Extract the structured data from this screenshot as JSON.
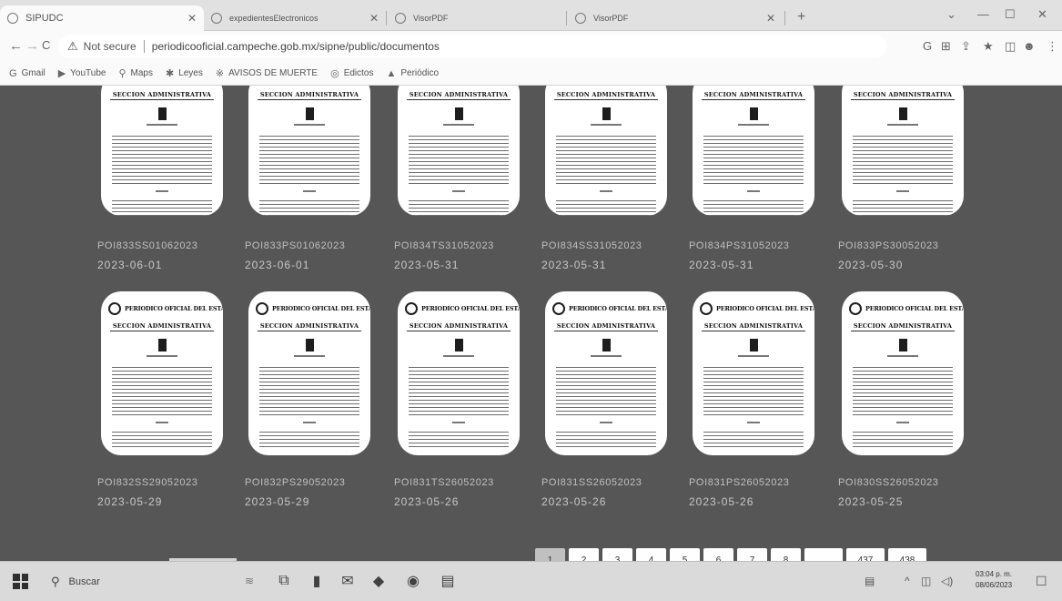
{
  "browser": {
    "tabs": [
      {
        "title": "SIPUDC",
        "active": true
      },
      {
        "title": "expedientesElectronicos",
        "active": false
      },
      {
        "title": "VisorPDF",
        "active": false
      },
      {
        "title": "VisorPDF",
        "active": false
      }
    ],
    "new_tab": "+",
    "window_controls": {
      "chevron": "⌄",
      "minimize": "—",
      "maximize": "☐",
      "close": "✕"
    },
    "nav": {
      "back": "←",
      "forward": "→",
      "reload": "C"
    },
    "address": {
      "security_icon": "warning-triangle-icon",
      "security_label": "Not secure",
      "url": "periodicooficial.campeche.gob.mx/sipne/public/documentos"
    },
    "omnibox_icons": [
      "google-icon",
      "translate-icon",
      "share-icon",
      "star-icon",
      "sidebar-icon",
      "profile-icon",
      "menu-dots-icon"
    ],
    "bookmarks": [
      {
        "icon": "G",
        "label": "Gmail"
      },
      {
        "icon": "▶",
        "label": "YouTube"
      },
      {
        "icon": "⚲",
        "label": "Maps"
      },
      {
        "icon": "✱",
        "label": "Leyes"
      },
      {
        "icon": "※",
        "label": "AVISOS DE MUERTE"
      },
      {
        "icon": "◎",
        "label": "Edictos"
      },
      {
        "icon": "▲",
        "label": "Periódico"
      }
    ]
  },
  "documents": {
    "card_header": "PERIODICO OFICIAL DEL ESTADO",
    "card_section": "SECCION ADMINISTRATIVA",
    "row1": [
      {
        "id": "POI833SS01062023",
        "date": "2023-06-01"
      },
      {
        "id": "POI833PS01062023",
        "date": "2023-06-01"
      },
      {
        "id": "POI834TS31052023",
        "date": "2023-05-31"
      },
      {
        "id": "POI834SS31052023",
        "date": "2023-05-31"
      },
      {
        "id": "POI834PS31052023",
        "date": "2023-05-31"
      },
      {
        "id": "POI833PS30052023",
        "date": "2023-05-30"
      }
    ],
    "row2": [
      {
        "id": "POI832SS29052023",
        "date": "2023-05-29"
      },
      {
        "id": "POI832PS29052023",
        "date": "2023-05-29"
      },
      {
        "id": "POI831TS26052023",
        "date": "2023-05-26"
      },
      {
        "id": "POI831SS26052023",
        "date": "2023-05-26"
      },
      {
        "id": "POI831PS26052023",
        "date": "2023-05-26"
      },
      {
        "id": "POI830SS26052023",
        "date": "2023-05-25"
      }
    ]
  },
  "pagination": {
    "pages": [
      "1",
      "2",
      "3",
      "4",
      "5",
      "6",
      "7",
      "8",
      "...",
      "437",
      "438"
    ],
    "current": "1"
  },
  "taskbar": {
    "search_placeholder": "Buscar",
    "apps": [
      "cortana-icon",
      "task-view-icon",
      "file-explorer-icon",
      "mail-icon",
      "store-icon",
      "chrome-icon",
      "pdf-icon"
    ],
    "tray": {
      "keyboard": "▤",
      "chevron": "^",
      "network": "◫",
      "volume": "◁)"
    },
    "time": "03:04 p. m.",
    "date": "08/06/2023"
  }
}
